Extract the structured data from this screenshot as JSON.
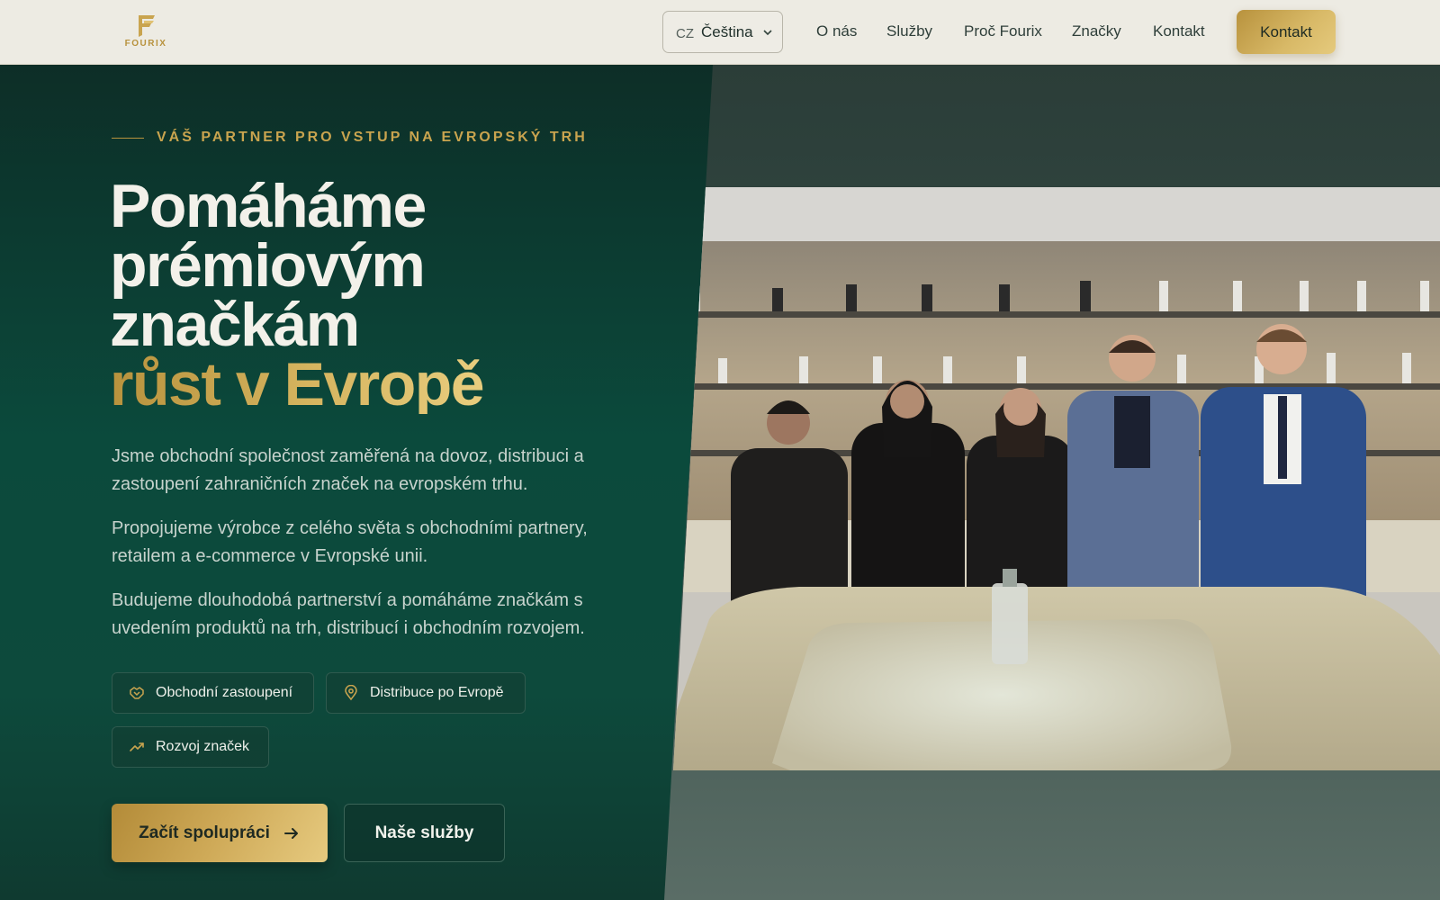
{
  "header": {
    "logo_text": "FOURIX",
    "language": {
      "code": "CZ",
      "name": "Čeština"
    },
    "nav": [
      "O nás",
      "Služby",
      "Proč Fourix",
      "Značky",
      "Kontakt"
    ],
    "cta_label": "Kontakt"
  },
  "hero": {
    "eyebrow": "VÁŠ PARTNER PRO VSTUP NA EVROPSKÝ TRH",
    "title_lines": [
      "Pomáháme",
      "prémiovým",
      "značkám"
    ],
    "title_accent": "růst v Evropě",
    "paragraphs": [
      "Jsme obchodní společnost zaměřená na dovoz, distribuci a zastoupení zahraničních značek na evropském trhu.",
      "Propojujeme výrobce z celého světa s obchodními partnery, retailem a e-commerce v Evropské unii.",
      "Budujeme dlouhodobá partnerství a pomáháme značkám s uvedením produktů na trh, distribucí i obchodním rozvojem."
    ],
    "tags": [
      {
        "label": "Obchodní zastoupení",
        "icon": "handshake-icon"
      },
      {
        "label": "Distribuce po Evropě",
        "icon": "map-pin-icon"
      },
      {
        "label": "Rozvoj značek",
        "icon": "trending-up-icon"
      }
    ],
    "primary_button": "Začít spolupráci",
    "secondary_button": "Naše služby"
  },
  "colors": {
    "gold": "#c9a44f",
    "dark_green": "#0b4a3c",
    "header_bg": "#edebe3"
  }
}
